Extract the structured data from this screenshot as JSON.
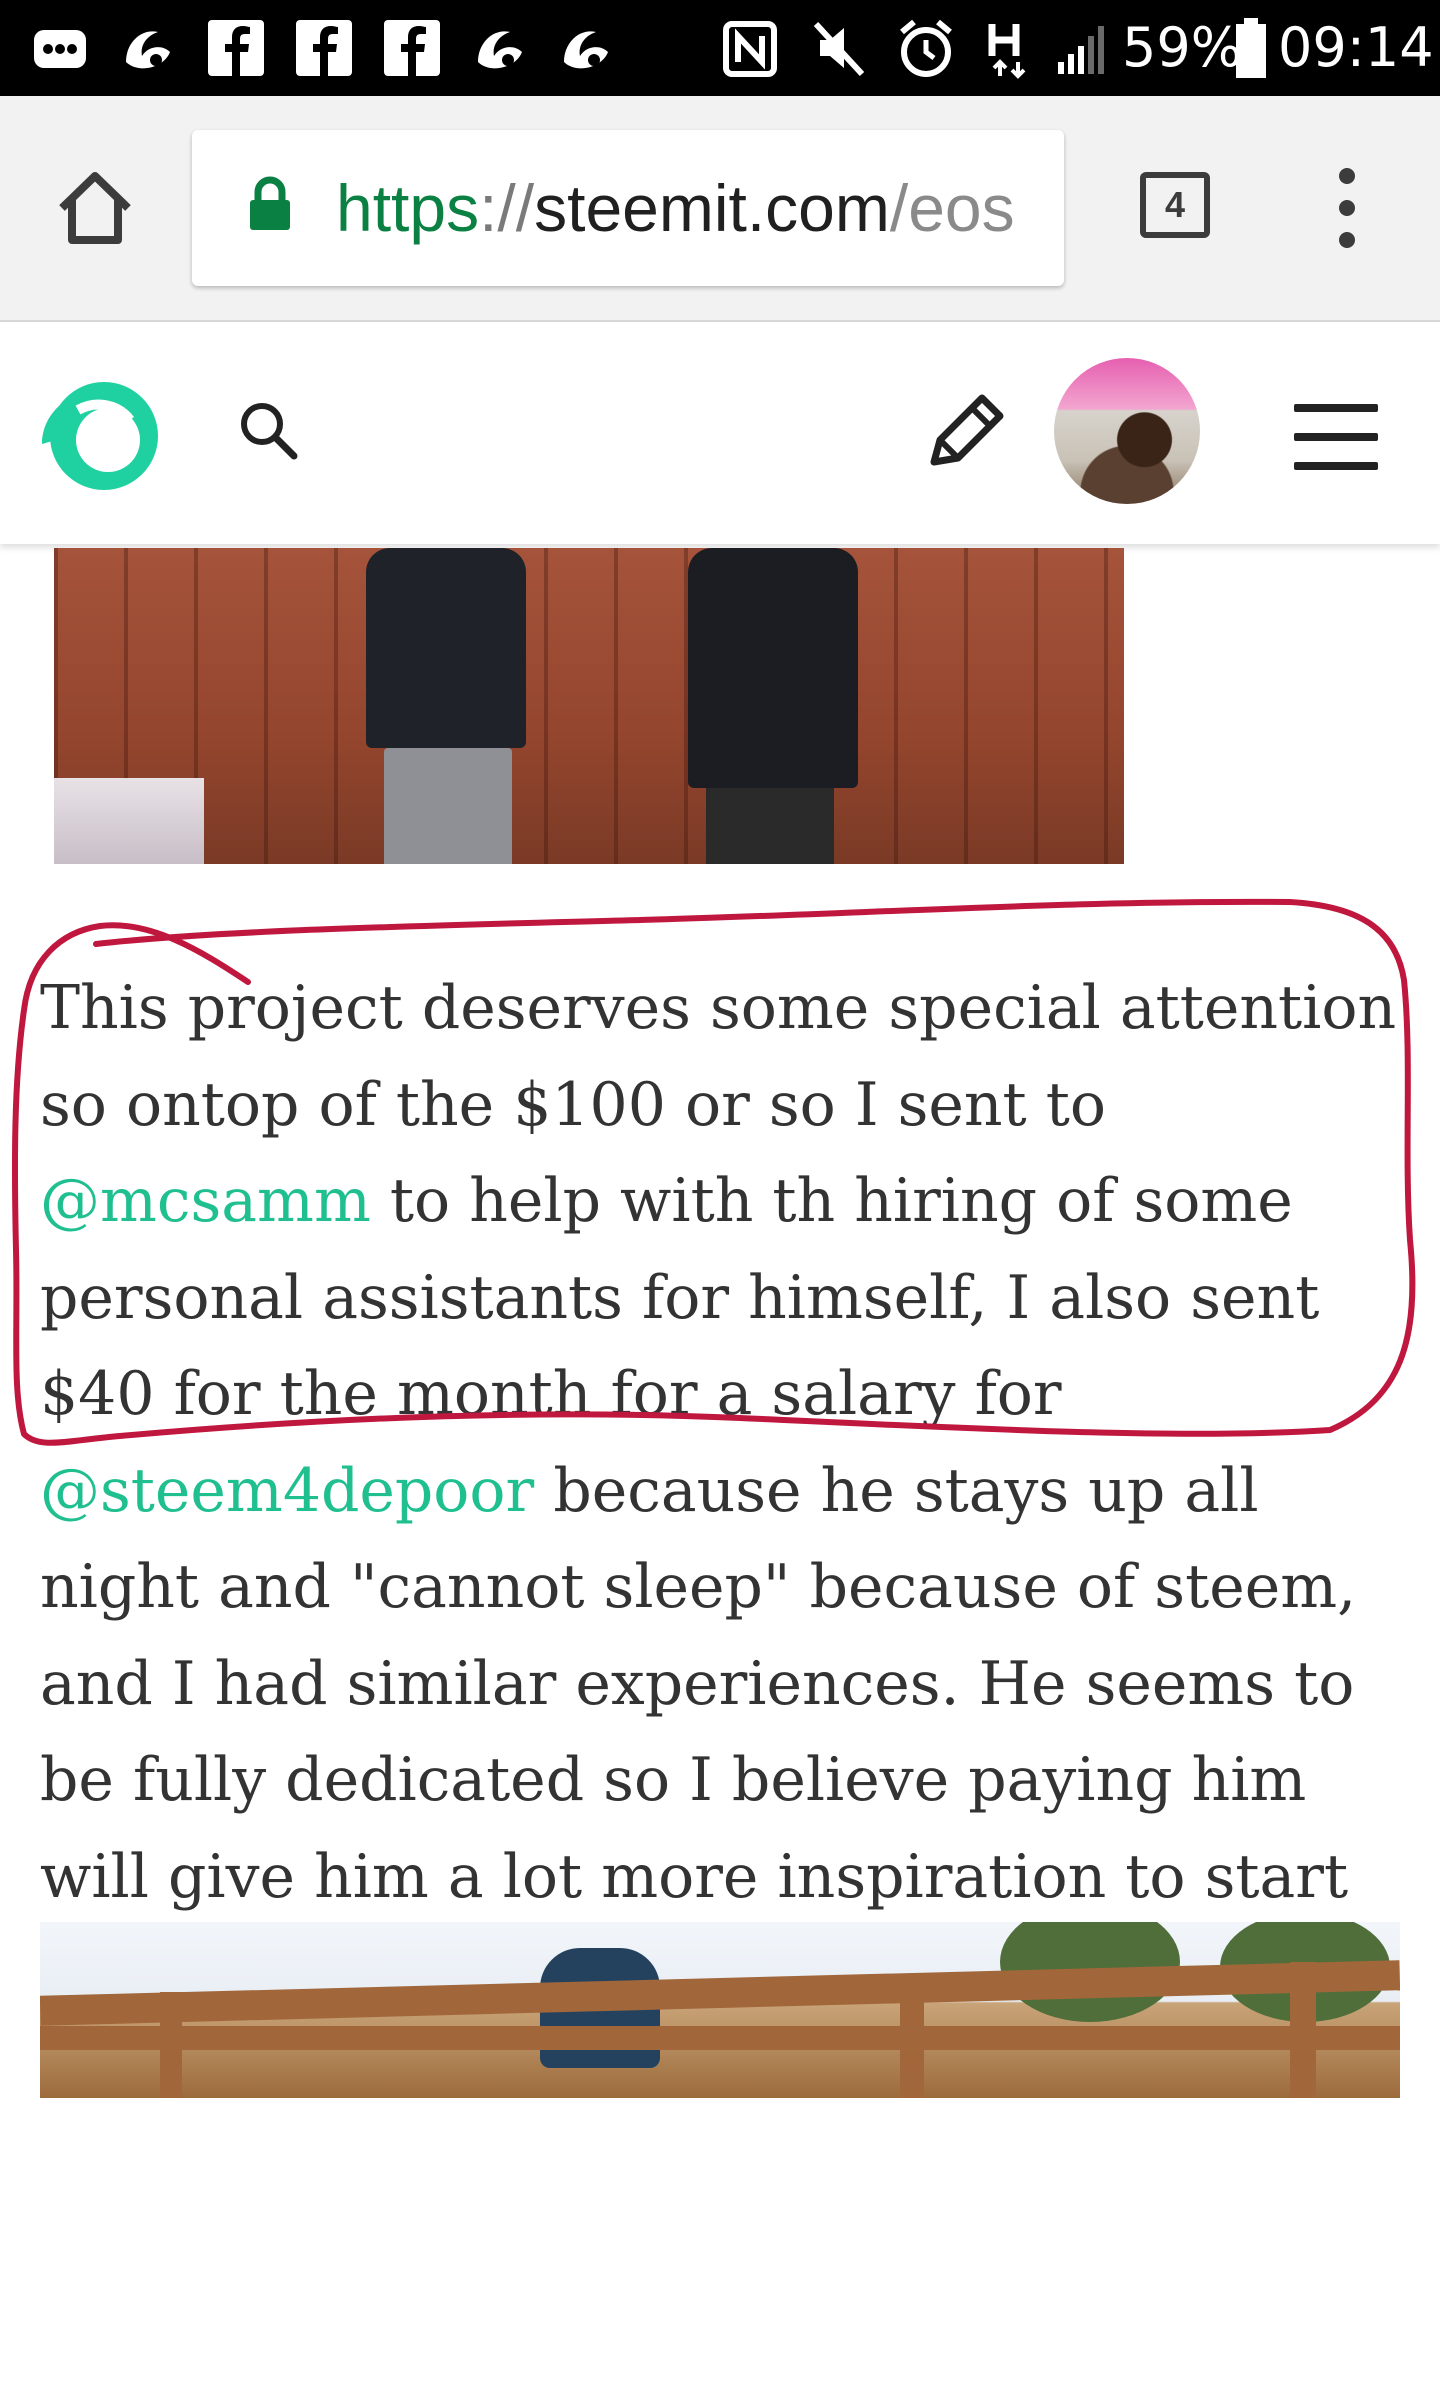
{
  "status_bar": {
    "battery": "59%",
    "time": "09:14",
    "icons": [
      "chat-notification-icon",
      "uc-browser-icon",
      "facebook-icon",
      "facebook-icon",
      "facebook-icon",
      "uc-browser-icon",
      "uc-browser-icon",
      "nfc-icon",
      "mute-icon",
      "alarm-icon",
      "h-plus-data-icon",
      "signal-icon",
      "battery-icon"
    ]
  },
  "browser": {
    "url_scheme": "https",
    "url_separator": "://",
    "url_host": "steemit.com",
    "url_path": "/eos",
    "tab_count": "4"
  },
  "article": {
    "paragraph_parts": [
      "This project deserves some special attention so ontop of the $100 or so I sent to ",
      "@mcsamm",
      " to help with th hiring of some personal assistants for himself, I also sent $40 for the month for a salary for ",
      "@steem4depoor",
      " because he stays up all night and \"cannot sleep\" because of steem, and I had similar experiences. He seems to be fully dedicated so I believe paying him will give him a lot more inspiration to start really working hard."
    ]
  },
  "colors": {
    "brand_green": "#1fbf8f",
    "secure_green": "#0b8043",
    "annotation_red": "#c0173f"
  }
}
